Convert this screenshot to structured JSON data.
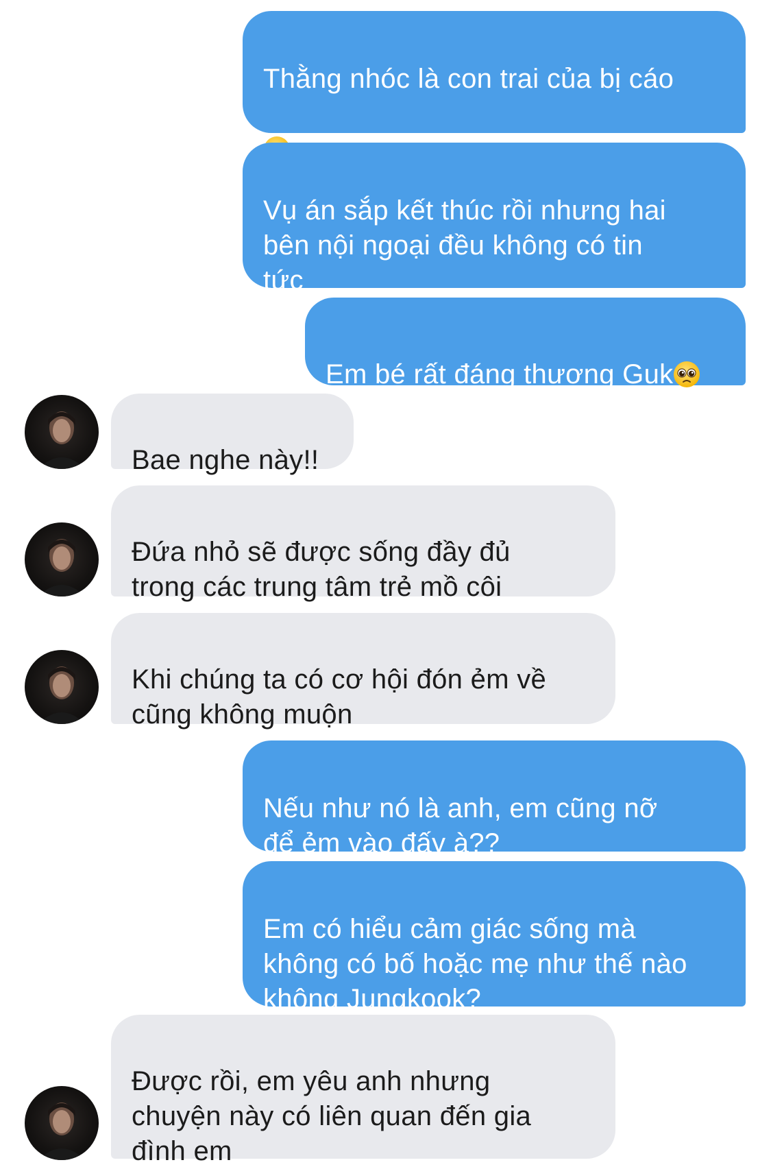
{
  "messages": [
    {
      "side": "sent",
      "text": "Thằng nhóc là con trai của bị cáo",
      "emoji": "persevering-face-icon"
    },
    {
      "side": "sent",
      "text": "Vụ án sắp kết thúc rồi nhưng hai\nbên nội ngoại đều không có tin\ntức"
    },
    {
      "side": "sent",
      "text": "Em bé rất đáng thương Guk",
      "emoji": "pleading-face-icon"
    },
    {
      "side": "received",
      "text": "Bae nghe này!!"
    },
    {
      "side": "received",
      "text": "Đứa nhỏ sẽ được sống đầy đủ\ntrong các trung tâm trẻ mồ côi"
    },
    {
      "side": "received",
      "text": "Khi chúng ta có cơ hội đón ẻm về\ncũng không muộn"
    },
    {
      "side": "sent",
      "text": "Nếu như nó là anh, em cũng nỡ\nđể ẻm vào đấy à??"
    },
    {
      "side": "sent",
      "text": "Em có hiểu cảm giác sống mà\nkhông có bố hoặc mẹ như thế nào\nkhông Jungkook?"
    },
    {
      "side": "received",
      "text": "Được rồi, em yêu anh nhưng\nchuyện này có liên quan đến gia\nđình em"
    }
  ],
  "colors": {
    "sent_bubble": "#4b9ee8",
    "received_bubble": "#e8e9ed",
    "sent_text": "#ffffff",
    "received_text": "#1b1b1b"
  }
}
